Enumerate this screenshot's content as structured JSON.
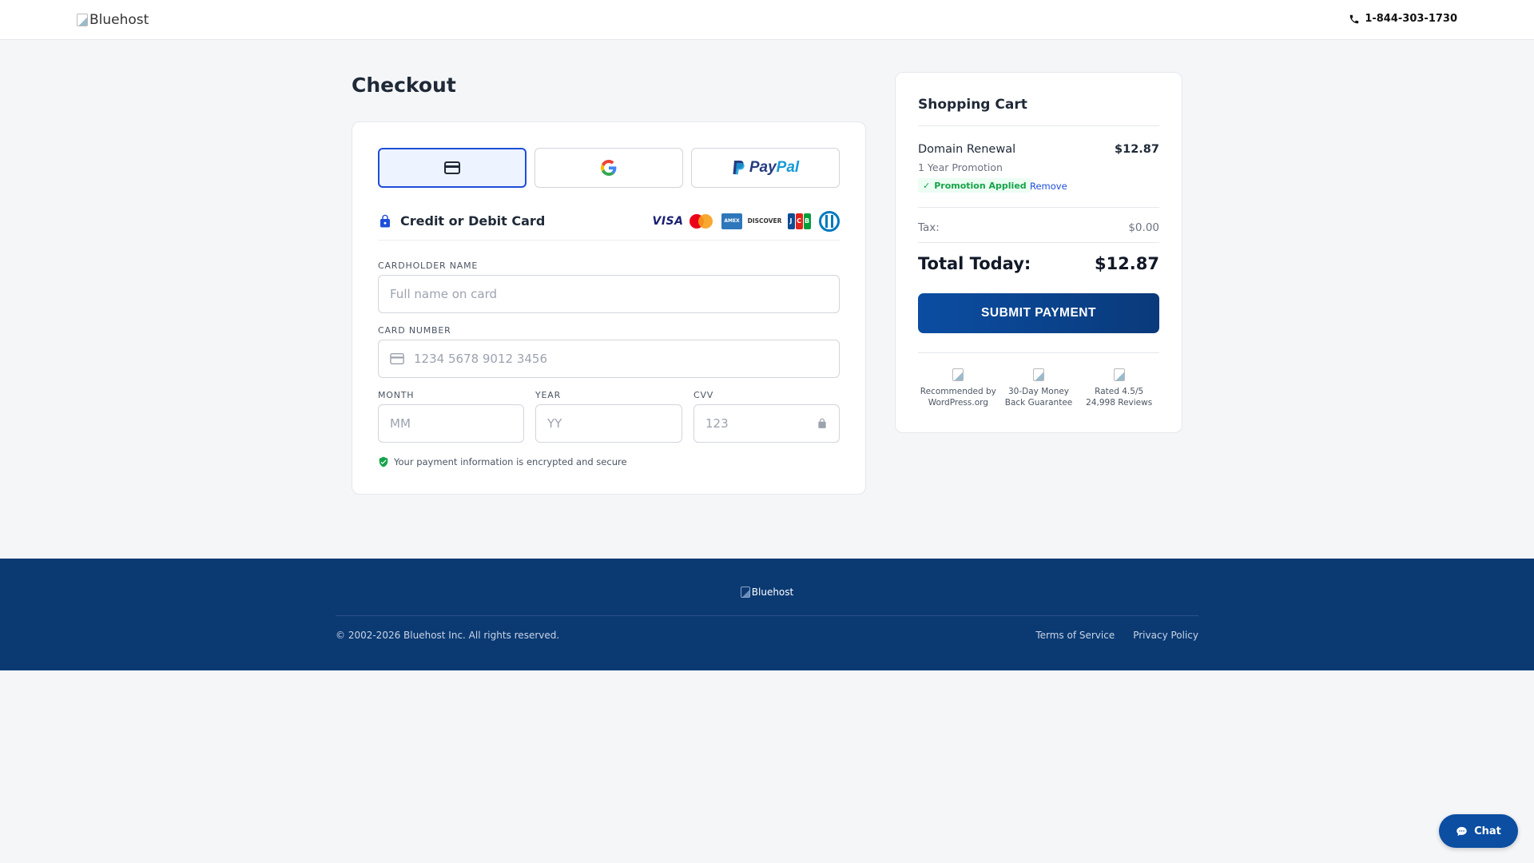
{
  "header": {
    "logo_alt": "Bluehost",
    "phone": "1-844-303-1730"
  },
  "checkout": {
    "title": "Checkout",
    "methods": [
      {
        "name": "card",
        "icon": "credit-card-icon",
        "active": true
      },
      {
        "name": "google-pay",
        "icon": "google-icon",
        "active": false
      },
      {
        "name": "paypal",
        "label_1": "Pay",
        "label_2": "Pal",
        "active": false
      }
    ],
    "card_section_label": "Credit or Debit Card",
    "brands": [
      "VISA",
      "Mastercard",
      "American Express",
      "DISCOVER",
      "JCB",
      "Diners Club"
    ],
    "fields": {
      "cardholder_label": "CARDHOLDER NAME",
      "cardholder_placeholder": "Full name on card",
      "card_number_label": "CARD NUMBER",
      "card_number_placeholder": "1234 5678 9012 3456",
      "month_label": "MONTH",
      "month_placeholder": "MM",
      "year_label": "YEAR",
      "year_placeholder": "YY",
      "cvv_label": "CVV",
      "cvv_placeholder": "123"
    },
    "secure_note": "Your payment information is encrypted and secure"
  },
  "cart": {
    "title": "Shopping Cart",
    "item": {
      "name": "Domain Renewal",
      "price": "$12.87",
      "term": "1 Year Promotion",
      "promo": "Promotion Applied",
      "remove": "Remove"
    },
    "tax_label": "Tax:",
    "tax_value": "$0.00",
    "total_label": "Total Today:",
    "total_value": "$12.87",
    "submit_label": "SUBMIT PAYMENT",
    "badges": [
      {
        "line1": "Recommended by",
        "line2": "WordPress.org"
      },
      {
        "line1": "30-Day Money",
        "line2": "Back Guarantee"
      },
      {
        "line1": "Rated 4.5/5",
        "line2": "24,998 Reviews"
      }
    ]
  },
  "footer": {
    "logo_alt": "Bluehost",
    "copyright": "© 2002-2026 Bluehost Inc. All rights reserved.",
    "links": [
      "Terms of Service",
      "Privacy Policy"
    ]
  },
  "chat": {
    "label": "Chat"
  },
  "colors": {
    "accent": "#1d4ed8",
    "footer_bg": "#0b3a73",
    "submit_bg": "#0b4da2",
    "promo_green": "#16a34a"
  }
}
